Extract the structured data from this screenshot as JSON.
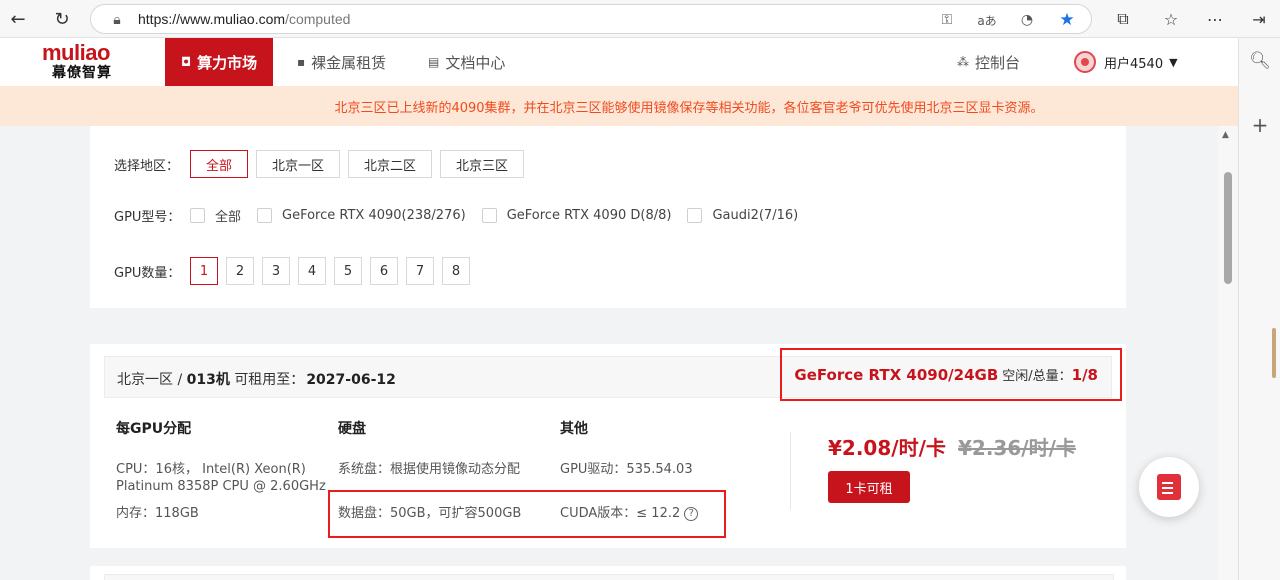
{
  "browser": {
    "url_host": "https://www.muliao.com",
    "url_path": "/computed"
  },
  "site": {
    "logo_top": "muliao",
    "logo_bottom": "幕僚智算",
    "nav": [
      {
        "label": "算力市场"
      },
      {
        "label": "裸金属租赁"
      },
      {
        "label": "文档中心"
      }
    ],
    "console_label": "控制台",
    "username": "用户4540"
  },
  "notice": "北京三区已上线新的4090集群，并在北京三区能够使用镜像保存等相关功能，各位客官老爷可优先使用北京三区显卡资源。",
  "filters": {
    "region_label": "选择地区：",
    "regions": [
      "全部",
      "北京一区",
      "北京二区",
      "北京三区"
    ],
    "selected_region": "全部",
    "gpu_model_label": "GPU型号：",
    "gpu_models": [
      "全部",
      "GeForce RTX 4090(238/276)",
      "GeForce RTX 4090 D(8/8)",
      "Gaudi2(7/16)"
    ],
    "gpu_count_label": "GPU数量：",
    "gpu_counts": [
      "1",
      "2",
      "3",
      "4",
      "5",
      "6",
      "7",
      "8"
    ],
    "selected_count": "1"
  },
  "machine": {
    "region": "北京一区",
    "sep": " / ",
    "machine_id": "013机",
    "rent_until_label": "可租用至：",
    "rent_until": "2027-06-12",
    "gpu_name": "GeForce RTX 4090/24GB",
    "free_total_label": "空闲/总量：",
    "free_total": "1/8",
    "col_gpu_title": "每GPU分配",
    "col_disk_title": "硬盘",
    "col_other_title": "其他",
    "cpu": "CPU：16核， Intel(R) Xeon(R) Platinum 8358P CPU @ 2.60GHz",
    "memory": "内存：118GB",
    "system_disk": "系统盘：根据使用镜像动态分配",
    "data_disk": "数据盘：50GB，可扩容500GB",
    "gpu_driver": "GPU驱动：535.54.03",
    "cuda": "CUDA版本：≤ 12.2",
    "price": "¥2.08/时/卡",
    "old_price": "¥2.36/时/卡",
    "rent_button": "1卡可租"
  }
}
